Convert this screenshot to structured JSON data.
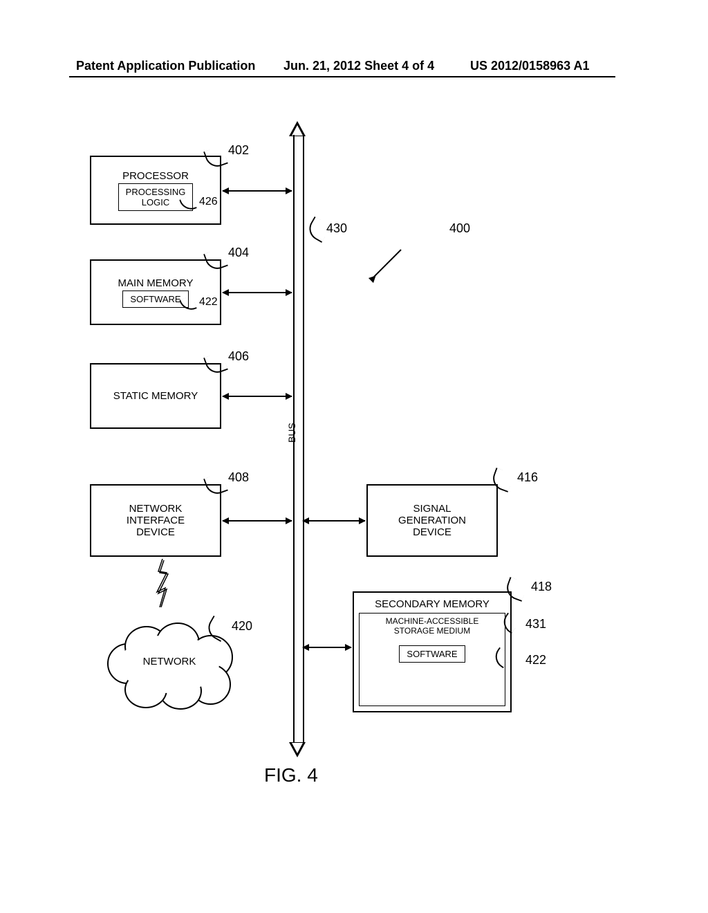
{
  "header": {
    "left": "Patent Application Publication",
    "mid": "Jun. 21, 2012  Sheet 4 of 4",
    "right": "US 2012/0158963 A1"
  },
  "refs": {
    "r400": "400",
    "r402": "402",
    "r404": "404",
    "r406": "406",
    "r408": "408",
    "r416": "416",
    "r418": "418",
    "r420": "420",
    "r422a": "422",
    "r422b": "422",
    "r426": "426",
    "r430": "430",
    "r431": "431"
  },
  "blocks": {
    "processor": "PROCESSOR",
    "processing_logic": "PROCESSING\nLOGIC",
    "main_memory": "MAIN MEMORY",
    "software": "SOFTWARE",
    "static_memory": "STATIC MEMORY",
    "network_interface": "NETWORK\nINTERFACE\nDEVICE",
    "signal_gen": "SIGNAL\nGENERATION\nDEVICE",
    "secondary_memory": "SECONDARY MEMORY",
    "machine_medium": "MACHINE-ACCESSIBLE\nSTORAGE MEDIUM",
    "software2": "SOFTWARE",
    "network": "NETWORK",
    "bus": "BUS"
  },
  "caption": "FIG. 4"
}
